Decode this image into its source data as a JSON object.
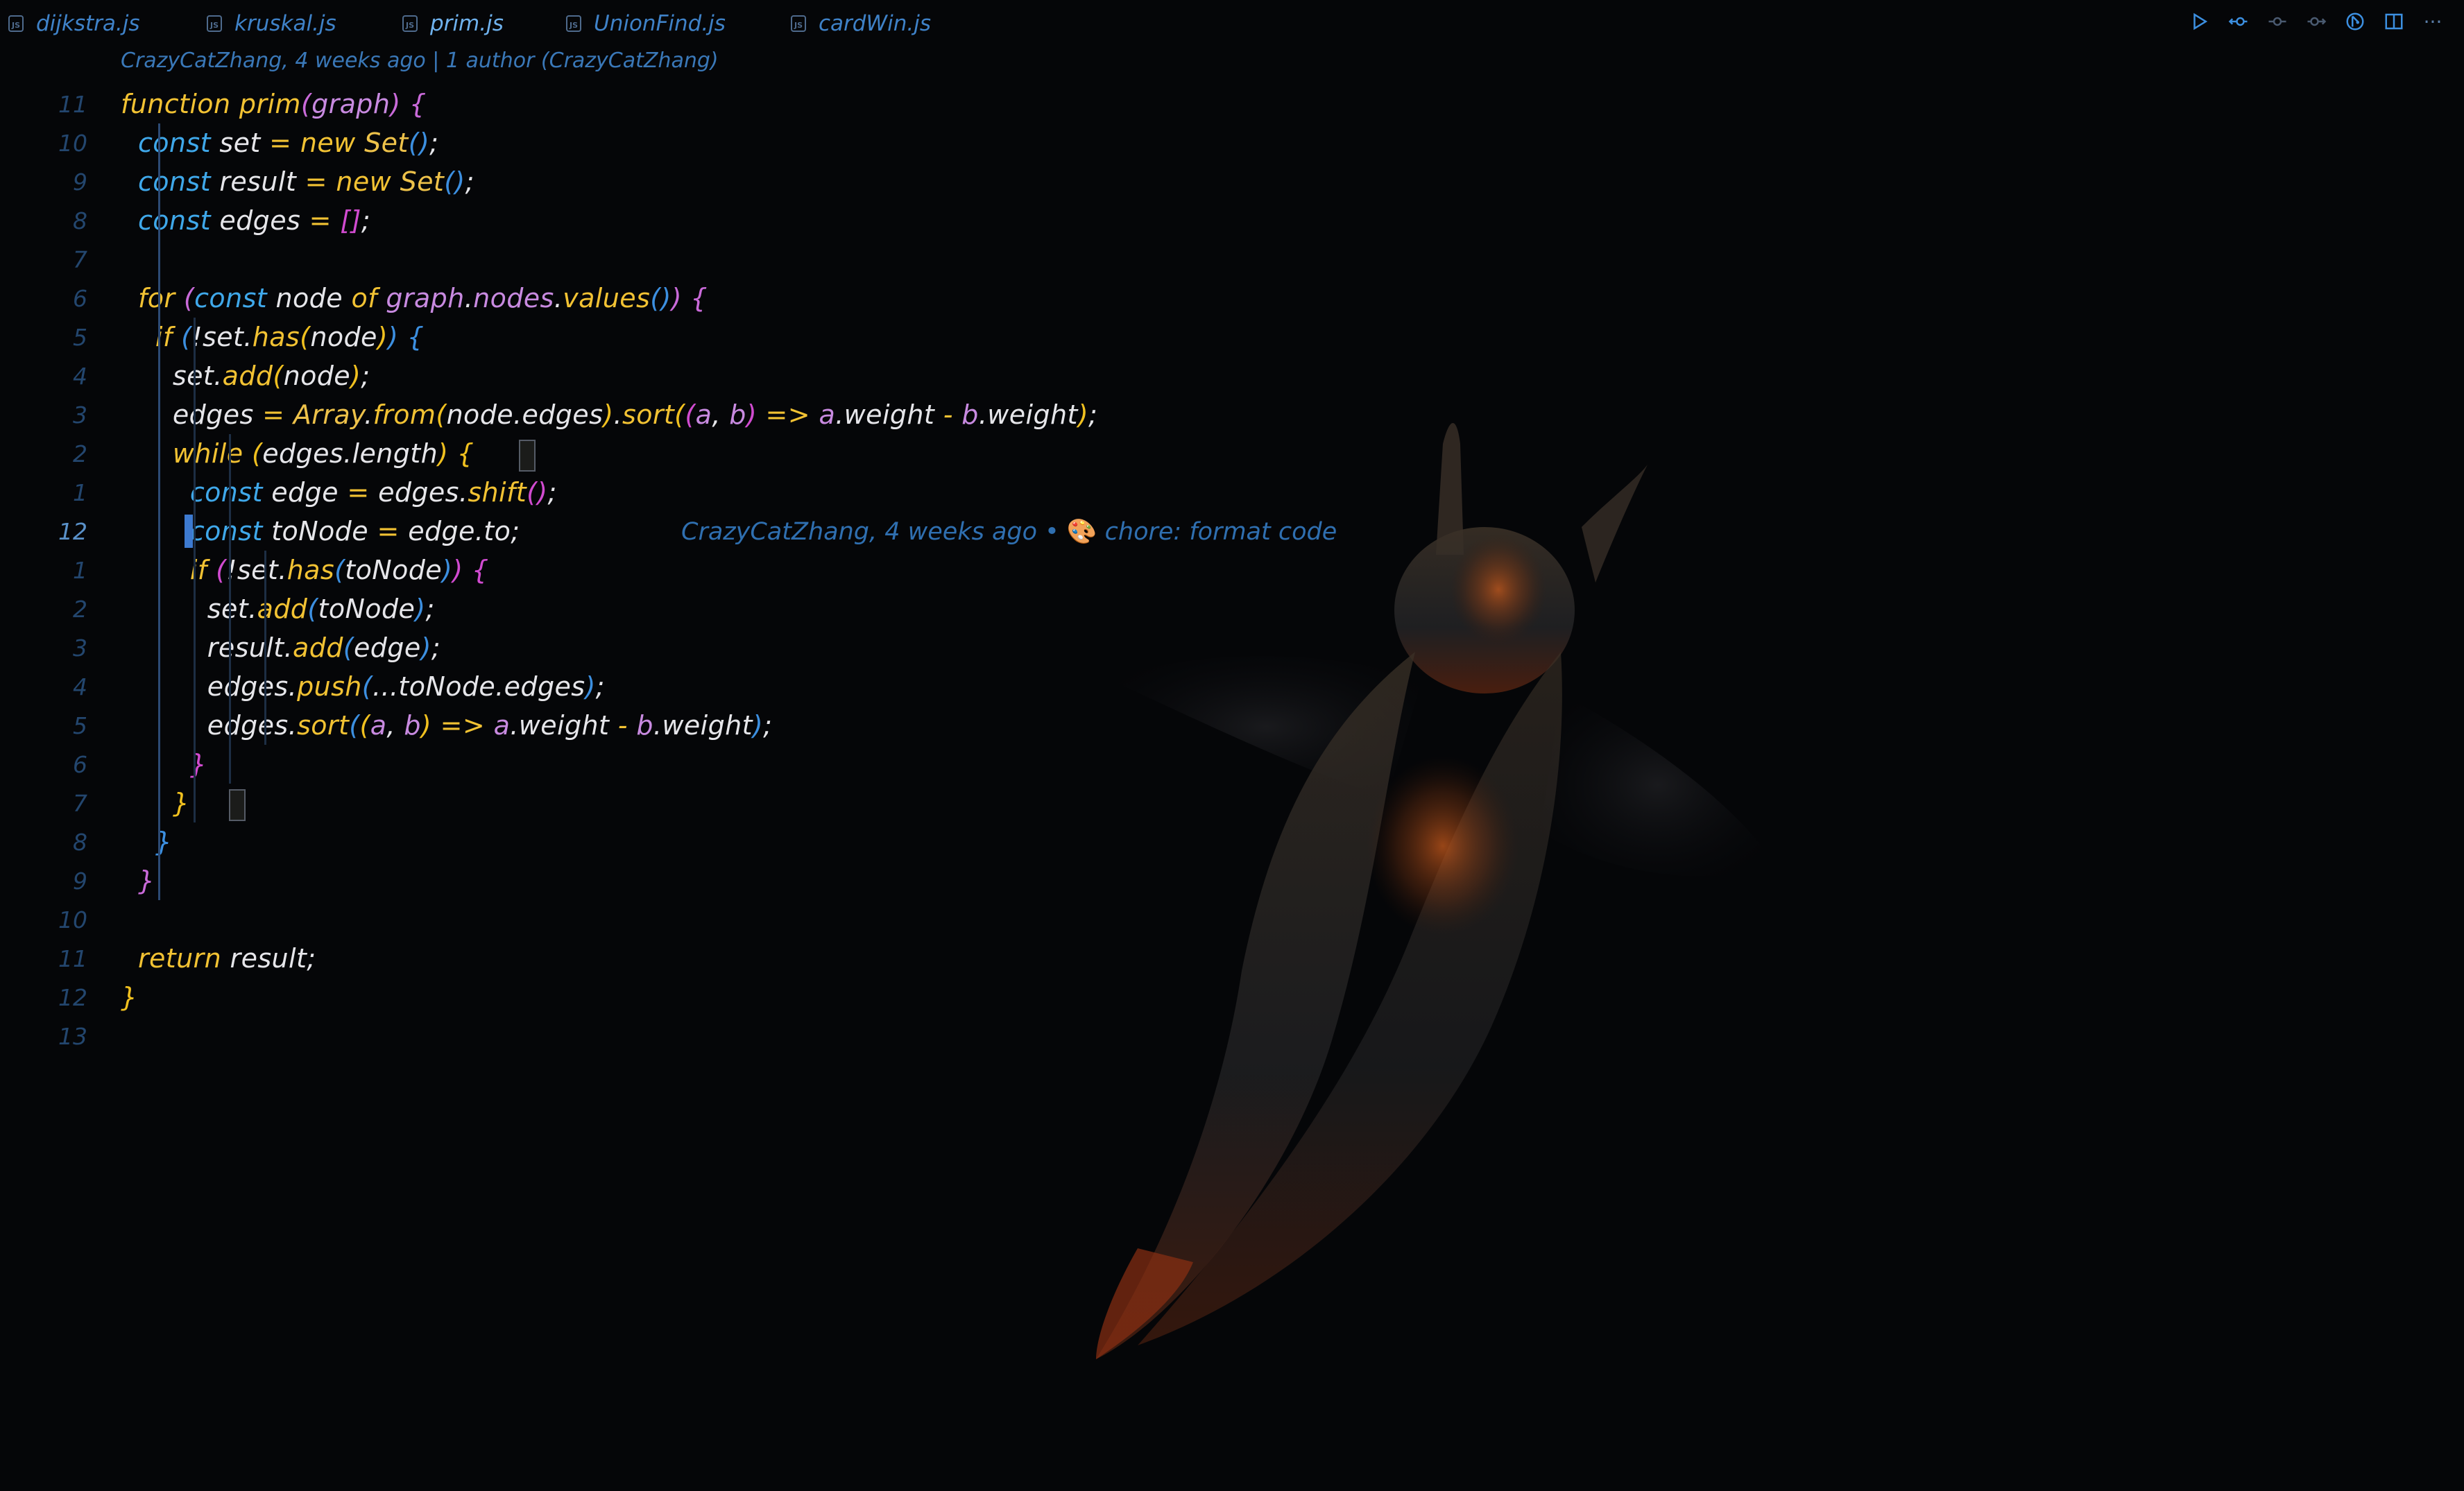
{
  "tabs": [
    {
      "label": "dijkstra.js",
      "icon": "js-file-icon",
      "active": false
    },
    {
      "label": "kruskal.js",
      "icon": "js-file-icon",
      "active": false
    },
    {
      "label": "prim.js",
      "icon": "js-file-icon",
      "active": true
    },
    {
      "label": "UnionFind.js",
      "icon": "js-file-icon",
      "active": false
    },
    {
      "label": "cardWin.js",
      "icon": "js-file-icon",
      "active": false
    }
  ],
  "file_icon_text": "JS",
  "actions": [
    "run-icon",
    "open-changes-icon",
    "previous-change-icon",
    "next-change-icon",
    "git-lens-icon",
    "split-editor-icon",
    "more-actions-icon"
  ],
  "more_glyph": "···",
  "editor": {
    "blame_header": "CrazyCatZhang, 4 weeks ago | 1 author (CrazyCatZhang)",
    "current_line": "12",
    "blame_inline": {
      "author_time": "CrazyCatZhang, 4 weeks ago • ",
      "emoji": "🎨",
      "message": " chore: format code"
    },
    "line_numbers": [
      "11",
      "10",
      "9",
      "8",
      "7",
      "6",
      "5",
      "4",
      "3",
      "2",
      "1",
      "12",
      "1",
      "2",
      "3",
      "4",
      "5",
      "6",
      "7",
      "8",
      "9",
      "10",
      "11",
      "12",
      "13"
    ],
    "lines": [
      [
        [
          "kw",
          "function "
        ],
        [
          "fn",
          "prim"
        ],
        [
          "pa",
          "("
        ],
        [
          "pr",
          "graph"
        ],
        [
          "pa",
          ")"
        ],
        [
          "id",
          " "
        ],
        [
          "pa",
          "{"
        ]
      ],
      [
        [
          "id",
          "  "
        ],
        [
          "st",
          "const "
        ],
        [
          "id",
          "set "
        ],
        [
          "op",
          "= "
        ],
        [
          "kw",
          "new "
        ],
        [
          "cl",
          "Set"
        ],
        [
          "pb",
          "()"
        ],
        [
          "id",
          ";"
        ]
      ],
      [
        [
          "id",
          "  "
        ],
        [
          "st",
          "const "
        ],
        [
          "id",
          "result "
        ],
        [
          "op",
          "= "
        ],
        [
          "kw",
          "new "
        ],
        [
          "cl",
          "Set"
        ],
        [
          "pb",
          "()"
        ],
        [
          "id",
          ";"
        ]
      ],
      [
        [
          "id",
          "  "
        ],
        [
          "st",
          "const "
        ],
        [
          "id",
          "edges "
        ],
        [
          "op",
          "= "
        ],
        [
          "pm",
          "[]"
        ],
        [
          "id",
          ";"
        ]
      ],
      [
        [
          "id",
          ""
        ]
      ],
      [
        [
          "id",
          "  "
        ],
        [
          "kw",
          "for "
        ],
        [
          "pa",
          "("
        ],
        [
          "st",
          "const "
        ],
        [
          "id",
          "node "
        ],
        [
          "kw",
          "of "
        ],
        [
          "pr",
          "graph"
        ],
        [
          "id",
          "."
        ],
        [
          "pr",
          "nodes"
        ],
        [
          "id",
          "."
        ],
        [
          "fn",
          "values"
        ],
        [
          "pb",
          "()"
        ],
        [
          "pa",
          ")"
        ],
        [
          "id",
          " "
        ],
        [
          "pa",
          "{"
        ]
      ],
      [
        [
          "id",
          "    "
        ],
        [
          "kw",
          "if "
        ],
        [
          "pb",
          "("
        ],
        [
          "id",
          "!set."
        ],
        [
          "fn",
          "has"
        ],
        [
          "py",
          "("
        ],
        [
          "id",
          "node"
        ],
        [
          "py",
          ")"
        ],
        [
          "pb",
          ")"
        ],
        [
          "id",
          " "
        ],
        [
          "pb",
          "{"
        ]
      ],
      [
        [
          "id",
          "      "
        ],
        [
          "id",
          "set."
        ],
        [
          "fn",
          "add"
        ],
        [
          "py",
          "("
        ],
        [
          "id",
          "node"
        ],
        [
          "py",
          ")"
        ],
        [
          "id",
          ";"
        ]
      ],
      [
        [
          "id",
          "      "
        ],
        [
          "id",
          "edges "
        ],
        [
          "op",
          "= "
        ],
        [
          "cl",
          "Array"
        ],
        [
          "id",
          "."
        ],
        [
          "fn",
          "from"
        ],
        [
          "py",
          "("
        ],
        [
          "id",
          "node.edges"
        ],
        [
          "py",
          ")"
        ],
        [
          "id",
          "."
        ],
        [
          "fn",
          "sort"
        ],
        [
          "py",
          "("
        ],
        [
          "pm",
          "("
        ],
        [
          "pr",
          "a"
        ],
        [
          "id",
          ", "
        ],
        [
          "pr",
          "b"
        ],
        [
          "pm",
          ")"
        ],
        [
          "op",
          " => "
        ],
        [
          "pr",
          "a"
        ],
        [
          "id",
          ".weight "
        ],
        [
          "op",
          "- "
        ],
        [
          "pr",
          "b"
        ],
        [
          "id",
          ".weight"
        ],
        [
          "py",
          ")"
        ],
        [
          "id",
          ";"
        ]
      ],
      [
        [
          "id",
          "      "
        ],
        [
          "kw",
          "while "
        ],
        [
          "py",
          "("
        ],
        [
          "id",
          "edges.length"
        ],
        [
          "py",
          ")"
        ],
        [
          "id",
          " "
        ],
        [
          "py",
          "{"
        ]
      ],
      [
        [
          "id",
          "        "
        ],
        [
          "st",
          "const "
        ],
        [
          "id",
          "edge "
        ],
        [
          "op",
          "= "
        ],
        [
          "id",
          "edges."
        ],
        [
          "fn",
          "shift"
        ],
        [
          "pm",
          "()"
        ],
        [
          "id",
          ";"
        ]
      ],
      [
        [
          "id",
          "        "
        ],
        [
          "st",
          "const "
        ],
        [
          "id",
          "toNode "
        ],
        [
          "op",
          "= "
        ],
        [
          "id",
          "edge.to;"
        ]
      ],
      [
        [
          "id",
          "        "
        ],
        [
          "kw",
          "if "
        ],
        [
          "pm",
          "("
        ],
        [
          "id",
          "!set."
        ],
        [
          "fn",
          "has"
        ],
        [
          "pb",
          "("
        ],
        [
          "id",
          "toNode"
        ],
        [
          "pb",
          ")"
        ],
        [
          "pm",
          ")"
        ],
        [
          "id",
          " "
        ],
        [
          "pm",
          "{"
        ]
      ],
      [
        [
          "id",
          "          "
        ],
        [
          "id",
          "set."
        ],
        [
          "fn",
          "add"
        ],
        [
          "pb",
          "("
        ],
        [
          "id",
          "toNode"
        ],
        [
          "pb",
          ")"
        ],
        [
          "id",
          ";"
        ]
      ],
      [
        [
          "id",
          "          "
        ],
        [
          "id",
          "result."
        ],
        [
          "fn",
          "add"
        ],
        [
          "pb",
          "("
        ],
        [
          "id",
          "edge"
        ],
        [
          "pb",
          ")"
        ],
        [
          "id",
          ";"
        ]
      ],
      [
        [
          "id",
          "          "
        ],
        [
          "id",
          "edges."
        ],
        [
          "fn",
          "push"
        ],
        [
          "pb",
          "("
        ],
        [
          "id",
          "...toNode.edges"
        ],
        [
          "pb",
          ")"
        ],
        [
          "id",
          ";"
        ]
      ],
      [
        [
          "id",
          "          "
        ],
        [
          "id",
          "edges."
        ],
        [
          "fn",
          "sort"
        ],
        [
          "pb",
          "("
        ],
        [
          "py",
          "("
        ],
        [
          "pr",
          "a"
        ],
        [
          "id",
          ", "
        ],
        [
          "pr",
          "b"
        ],
        [
          "py",
          ")"
        ],
        [
          "op",
          " => "
        ],
        [
          "pr",
          "a"
        ],
        [
          "id",
          ".weight "
        ],
        [
          "op",
          "- "
        ],
        [
          "pr",
          "b"
        ],
        [
          "id",
          ".weight"
        ],
        [
          "pb",
          ")"
        ],
        [
          "id",
          ";"
        ]
      ],
      [
        [
          "id",
          "        "
        ],
        [
          "pm",
          "}"
        ]
      ],
      [
        [
          "id",
          "      "
        ],
        [
          "py",
          "}"
        ]
      ],
      [
        [
          "id",
          "    "
        ],
        [
          "pb",
          "}"
        ]
      ],
      [
        [
          "id",
          "  "
        ],
        [
          "pa",
          "}"
        ]
      ],
      [
        [
          "id",
          ""
        ]
      ],
      [
        [
          "id",
          "  "
        ],
        [
          "kw",
          "return "
        ],
        [
          "id",
          "result;"
        ]
      ],
      [
        [
          "py",
          "}"
        ]
      ],
      [
        [
          "id",
          ""
        ]
      ]
    ]
  }
}
